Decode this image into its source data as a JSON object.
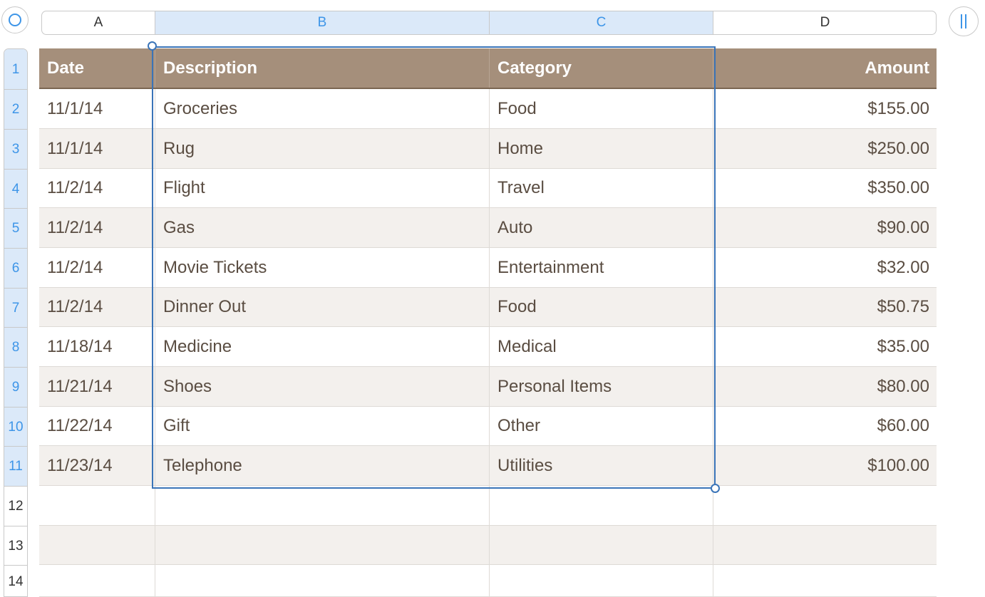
{
  "column_headers": [
    {
      "label": "A",
      "selected": false
    },
    {
      "label": "B",
      "selected": true
    },
    {
      "label": "C",
      "selected": true
    },
    {
      "label": "D",
      "selected": false
    }
  ],
  "row_headers": [
    "1",
    "2",
    "3",
    "4",
    "5",
    "6",
    "7",
    "8",
    "9",
    "10",
    "11",
    "12",
    "13",
    "14"
  ],
  "selected_rows": [
    "1",
    "2",
    "3",
    "4",
    "5",
    "6",
    "7",
    "8",
    "9",
    "10",
    "11"
  ],
  "table": {
    "header": [
      "Date",
      "Description",
      "Category",
      "Amount"
    ],
    "rows": [
      [
        "11/1/14",
        "Groceries",
        "Food",
        "$155.00"
      ],
      [
        "11/1/14",
        "Rug",
        "Home",
        "$250.00"
      ],
      [
        "11/2/14",
        "Flight",
        "Travel",
        "$350.00"
      ],
      [
        "11/2/14",
        "Gas",
        "Auto",
        "$90.00"
      ],
      [
        "11/2/14",
        "Movie Tickets",
        "Entertainment",
        "$32.00"
      ],
      [
        "11/2/14",
        "Dinner Out",
        "Food",
        "$50.75"
      ],
      [
        "11/18/14",
        "Medicine",
        "Medical",
        "$35.00"
      ],
      [
        "11/21/14",
        "Shoes",
        "Personal Items",
        "$80.00"
      ],
      [
        "11/22/14",
        "Gift",
        "Other",
        "$60.00"
      ],
      [
        "11/23/14",
        "Telephone",
        "Utilities",
        "$100.00"
      ],
      [
        "",
        "",
        "",
        ""
      ],
      [
        "",
        "",
        "",
        ""
      ],
      [
        "",
        "",
        "",
        ""
      ]
    ]
  },
  "selection": {
    "range": "B1:C11"
  },
  "colors": {
    "header_bg": "#a58f7b",
    "alt_row_bg": "#f3f0ed",
    "selection_accent": "#3d95e8",
    "selection_border": "#3a74b8",
    "text": "#5a4d42"
  },
  "icons": {
    "select_all": "circle-select-icon",
    "freeze": "freeze-columns-icon"
  }
}
